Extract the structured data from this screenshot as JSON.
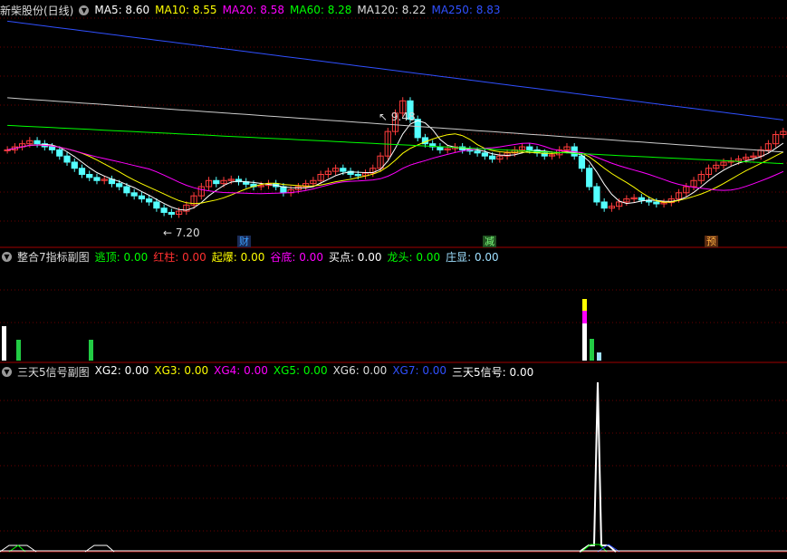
{
  "main_panel": {
    "title": "新柴股份(日线)",
    "ma_labels": [
      {
        "text": "MA5: 8.60",
        "color": "#ffffff"
      },
      {
        "text": "MA10: 8.55",
        "color": "#ffff00"
      },
      {
        "text": "MA20: 8.58",
        "color": "#ff00ff"
      },
      {
        "text": "MA60: 8.28",
        "color": "#00ff00"
      },
      {
        "text": "MA120: 8.22",
        "color": "#dddddd"
      },
      {
        "text": "MA250: 8.83",
        "color": "#3050ff"
      }
    ],
    "high_label": "9.48",
    "low_label": "7.20",
    "badges": [
      {
        "text": "财",
        "color": "#3aa0ff",
        "bg": "#1a2a55"
      },
      {
        "text": "减",
        "color": "#7cff7c",
        "bg": "#1f4f1f"
      },
      {
        "text": "预",
        "color": "#ffb040",
        "bg": "#5a2a10"
      }
    ]
  },
  "sub1": {
    "title": "整合7指标副图",
    "labels": [
      {
        "text": "逃顶: 0.00",
        "color": "#00ff00"
      },
      {
        "text": "红柱: 0.00",
        "color": "#ff3030"
      },
      {
        "text": "起爆: 0.00",
        "color": "#ffff00"
      },
      {
        "text": "谷底: 0.00",
        "color": "#ff00ff"
      },
      {
        "text": "买点: 0.00",
        "color": "#ffffff"
      },
      {
        "text": "龙头: 0.00",
        "color": "#00ff00"
      },
      {
        "text": "庄显: 0.00",
        "color": "#9fe0ff"
      }
    ]
  },
  "sub2": {
    "title": "三天5信号副图",
    "labels": [
      {
        "text": "XG2: 0.00",
        "color": "#ffffff"
      },
      {
        "text": "XG3: 0.00",
        "color": "#ffff00"
      },
      {
        "text": "XG4: 0.00",
        "color": "#ff00ff"
      },
      {
        "text": "XG5: 0.00",
        "color": "#00ff00"
      },
      {
        "text": "XG6: 0.00",
        "color": "#dddddd"
      },
      {
        "text": "XG7: 0.00",
        "color": "#3050ff"
      },
      {
        "text": "三天5信号: 0.00",
        "color": "#ffffff"
      }
    ]
  }
}
